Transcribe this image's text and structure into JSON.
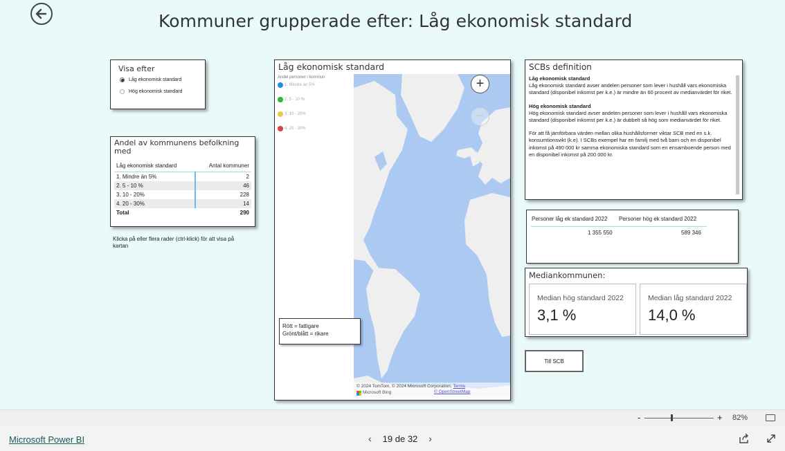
{
  "page": {
    "title": "Kommuner grupperade efter: Låg ekonomisk standard",
    "back_icon": "arrow-left-circle-icon"
  },
  "slicer": {
    "title": "Visa efter",
    "options": [
      {
        "label": "Låg ekonomisk standard",
        "selected": true
      },
      {
        "label": "Hög ekonomisk standard",
        "selected": false
      }
    ]
  },
  "group_table": {
    "title": "Andel av kommunens befolkning med",
    "columns": [
      "Låg ekonomisk standard",
      "Antal kommuner"
    ],
    "rows": [
      {
        "label": "1. Mindre än 5%",
        "value": "2"
      },
      {
        "label": "2. 5 - 10 %",
        "value": "46"
      },
      {
        "label": "3. 10 - 20%",
        "value": "228"
      },
      {
        "label": "4. 20 - 30%",
        "value": "14"
      }
    ],
    "total": {
      "label": "Total",
      "value": "290"
    }
  },
  "hint": "Klicka på eller flera rader (ctrl-klick) för att visa på kartan",
  "map": {
    "title": "Låg ekonomisk standard",
    "legend_title": "Andel personer i kommun",
    "legend": [
      {
        "label": "1. Mindre än 5%",
        "color": "#1f8fe5"
      },
      {
        "label": "2. 5 - 10 %",
        "color": "#2db82d"
      },
      {
        "label": "3. 10 - 20%",
        "color": "#e9c94a"
      },
      {
        "label": "4. 20 - 30%",
        "color": "#d64545"
      }
    ],
    "zoom_in": "+",
    "zoom_out": "−",
    "attribution": "© 2024 TomTom, © 2024 Microsoft Corporation",
    "terms": "Terms",
    "osm": "© OpenStreetMap",
    "bing": "Microsoft Bing",
    "note": [
      "Rött = fattigare",
      "Grönt/blått = rikare"
    ]
  },
  "definition": {
    "title": "SCBs definition",
    "low_heading": "Låg ekonomisk standard",
    "low_text": "Låg ekonomisk standard avser andelen personer som lever i hushåll vars ekonomiska standard (disponibel inkomst per k.e.) är mindre än 60 procent av medianvärdet för riket.",
    "high_heading": "Hög ekonomisk standard",
    "high_text": "Hög ekonomisk standard avser andelen personer som lever i hushåll vars ekonomiska standard (disponibel inkomst per k.e.) är dubbelt så hög som medianvärdet för riket.",
    "extra_text": "För att få jämförbara värden mellan olika hushållsformer viktar SCB med en s.k. konsumtionsvikt (k.e). I SCBs exempel har en familj med två barn och en disponibel inkomst på 490 000 kr samma ekonomiska standard som en ensamboende person med en disponibel inkomst på 200 000 kr."
  },
  "persons": {
    "col1": "Personer låg ek standard 2022",
    "col2": "Personer hög ek standard 2022",
    "val1": "1 355 550",
    "val2": "589 346"
  },
  "median": {
    "title": "Mediankommunen:",
    "kpi1_label": "Median hög standard 2022",
    "kpi1_value": "3,1 %",
    "kpi2_label": "Median låg standard 2022",
    "kpi2_value": "14,0 %"
  },
  "scb_button": "Till SCB",
  "zoom": {
    "minus": "-",
    "plus": "+",
    "percent": "82%",
    "level": 0.82
  },
  "footer": {
    "brand": "Microsoft Power BI",
    "page_indicator": "19 de 32",
    "prev": "‹",
    "next": "›"
  }
}
